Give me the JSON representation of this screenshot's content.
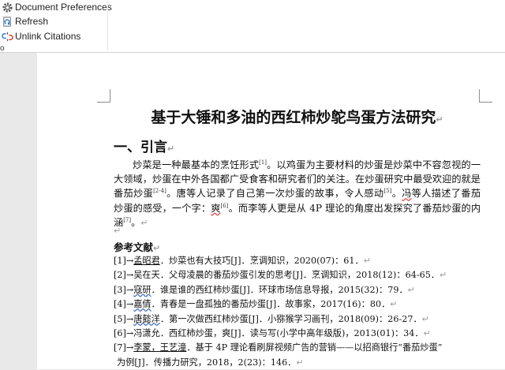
{
  "ribbon": {
    "items": [
      {
        "label": "Document Preferences",
        "icon": "gear-icon"
      },
      {
        "label": "Refresh",
        "icon": "refresh-icon"
      },
      {
        "label": "Unlink Citations",
        "icon": "unlink-icon"
      }
    ],
    "group_label": "o"
  },
  "document": {
    "title": "基于大锤和多油的西红柿炒鸵鸟蛋方法研究",
    "heading": "一、引言",
    "para": [
      "炒菜是一种最基本的烹饪形式",
      "[1]",
      "。以鸡蛋为主要材料的炒蛋是炒菜中不容忽视的一大领域，炒蛋在中外各国都广受食客和研究者们的关注。在炒蛋研究中最受欢迎的就是番茄炒蛋",
      "[2-4]",
      "。唐等人记录了自己第一次炒蛋的故事，令人感动",
      "[5]",
      "。",
      "冯",
      "等人描述了番茄炒蛋的感受，一个字：",
      "爽",
      "[6]",
      "。而李等人更是从 4P 理论的角度出发探究了番茄炒蛋的内涵",
      "[7]",
      "。"
    ],
    "refs_heading": "参考文献",
    "refs": [
      {
        "num": "[1]→",
        "author": "孟昭君",
        "text": "．炒菜也有大技巧[J]．烹调知识，2020(07)：61．"
      },
      {
        "num": "[2]→",
        "author": "吴在天",
        "text": "．父母凌晨的番茄炒蛋引发的思考[J]．烹调知识，2018(12)：64-65．"
      },
      {
        "num": "[3]→",
        "author": "寇研",
        "text": "．谁是谁的西红柿炒蛋[J]．环球市场信息导报，2015(32)：79．"
      },
      {
        "num": "[4]→",
        "author": "嘉倩",
        "text": "．青春是一盘孤独的番茄炒蛋[J]．故事家，2017(16)：80．"
      },
      {
        "num": "[5]→",
        "author": "唐懿洋",
        "text": "．第一次做西红柿炒蛋[J]．小猕猴学习画刊，2018(09)：26-27．"
      },
      {
        "num": "[6]→",
        "author": "冯潇允",
        "text": "．西红柿炒蛋，爽[J]．读与写(小学中高年级版)，2013(01)：34．"
      },
      {
        "num": "[7]→",
        "author": "李蒙，王艺潼",
        "text": "．基于 4P 理论看刷屏视频广告的营销——以招商银行“番茄炒蛋”"
      },
      {
        "num": "",
        "author": "",
        "text": "为例[J]．传播力研究，2018，2(23)：146．"
      }
    ]
  },
  "marks": {
    "paragraph": "↵"
  }
}
